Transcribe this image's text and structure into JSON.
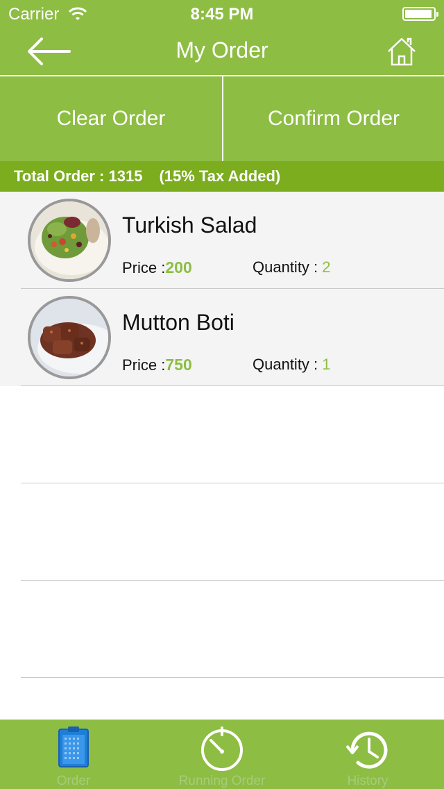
{
  "status_bar": {
    "carrier": "Carrier",
    "time": "8:45 PM"
  },
  "nav": {
    "title": "My Order",
    "back_icon": "back-arrow-icon",
    "home_icon": "home-icon"
  },
  "actions": {
    "clear_label": "Clear Order",
    "confirm_label": "Confirm Order"
  },
  "total": {
    "text": "Total Order : 1315",
    "tax_note": "(15% Tax Added)"
  },
  "orders": [
    {
      "name": "Turkish Salad",
      "price_label": "Price :",
      "price": "200",
      "quantity_label": "Quantity :",
      "quantity": "2"
    },
    {
      "name": "Mutton Boti",
      "price_label": "Price :",
      "price": "750",
      "quantity_label": "Quantity :",
      "quantity": "1"
    }
  ],
  "tabs": [
    {
      "label": "Order",
      "icon": "order-clipboard-icon"
    },
    {
      "label": "Running Order",
      "icon": "timer-icon"
    },
    {
      "label": "History",
      "icon": "history-clock-icon"
    }
  ],
  "colors": {
    "primary": "#8dbd43",
    "total_bar": "#7bad1f",
    "list_bg": "#f3f4f3",
    "accent_text": "#8dbd43"
  }
}
